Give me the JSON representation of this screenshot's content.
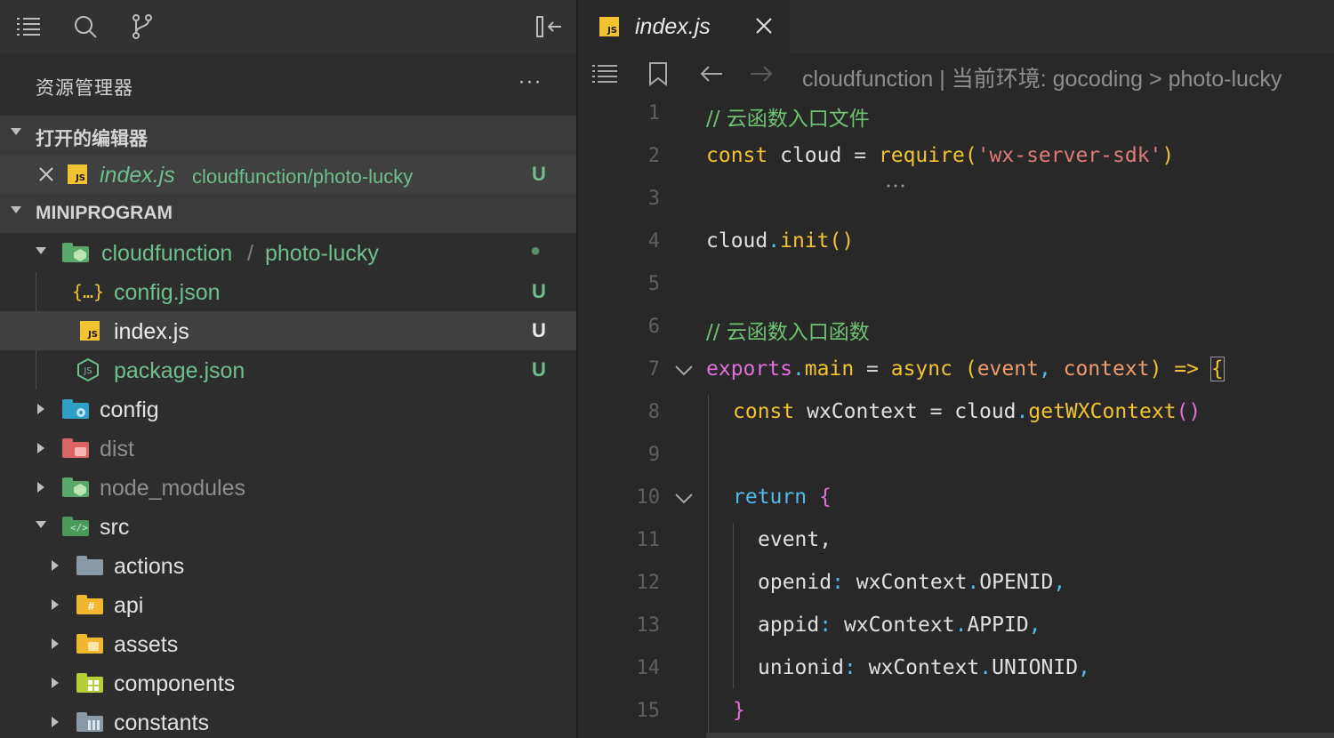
{
  "sidebar": {
    "title": "资源管理器",
    "more": "···",
    "open_editors": {
      "header": "打开的编辑器",
      "item": {
        "name": "index.js",
        "path": "cloudfunction/photo-lucky",
        "badge": "U"
      }
    },
    "project": {
      "header": "MINIPROGRAM",
      "items": [
        {
          "name": "cloudfunction",
          "sep": " / ",
          "name2": "photo-lucky",
          "status": "●"
        },
        {
          "name": "config.json",
          "badge": "U",
          "icon": "json-icon"
        },
        {
          "name": "index.js",
          "badge": "U",
          "icon": "js-icon"
        },
        {
          "name": "package.json",
          "badge": "U",
          "icon": "node-icon"
        },
        {
          "name": "config"
        },
        {
          "name": "dist"
        },
        {
          "name": "node_modules"
        },
        {
          "name": "src"
        },
        {
          "name": "actions"
        },
        {
          "name": "api"
        },
        {
          "name": "assets"
        },
        {
          "name": "components"
        },
        {
          "name": "constants"
        }
      ]
    }
  },
  "editor": {
    "tab": {
      "title": "index.js",
      "icon_text": "JS"
    },
    "breadcrumb": "cloudfunction | 当前环境: gocoding > photo-lucky",
    "line_numbers": [
      "1",
      "2",
      "3",
      "4",
      "5",
      "6",
      "7",
      "8",
      "9",
      "10",
      "11",
      "12",
      "13",
      "14",
      "15"
    ],
    "code": {
      "l1": "// 云函数入口文件",
      "l2": {
        "const": "const",
        "name": " cloud ",
        "eq": "=",
        "fn": " require",
        "p1": "(",
        "str": "'wx-server-sdk'",
        "p2": ")"
      },
      "l4": {
        "obj": "cloud",
        "dot": ".",
        "fn": "init",
        "paren": "()"
      },
      "l6": "// 云函数入口函数",
      "l7": {
        "obj": "exports",
        "dot": ".",
        "prop": "main",
        "eq": " = ",
        "async": "async",
        "p1": " (",
        "a1": "event",
        "comma": ", ",
        "a2": "context",
        "p2": ")",
        "arrow": " => ",
        "brace": "{"
      },
      "l8": {
        "const": "const",
        "name": " wxContext ",
        "eq": "=",
        "obj": " cloud",
        "dot": ".",
        "fn": "getWXContext",
        "paren": "()"
      },
      "l10": {
        "ret": "return",
        "brace": " {"
      },
      "l11": "event,",
      "l12": {
        "key": "openid",
        "colon": ": ",
        "obj": "wxContext",
        "dot": ".",
        "prop": "OPENID",
        "comma": ","
      },
      "l13": {
        "key": "appid",
        "colon": ": ",
        "obj": "wxContext",
        "dot": ".",
        "prop": "APPID",
        "comma": ","
      },
      "l14": {
        "key": "unionid",
        "colon": ": ",
        "obj": "wxContext",
        "dot": ".",
        "prop": "UNIONID",
        "comma": ","
      },
      "l15": "}"
    }
  },
  "colors": {
    "accent_green": "#6fbf8d",
    "js_yellow": "#f1c232",
    "background": "#282828",
    "sidebar": "#2d2d2d"
  }
}
